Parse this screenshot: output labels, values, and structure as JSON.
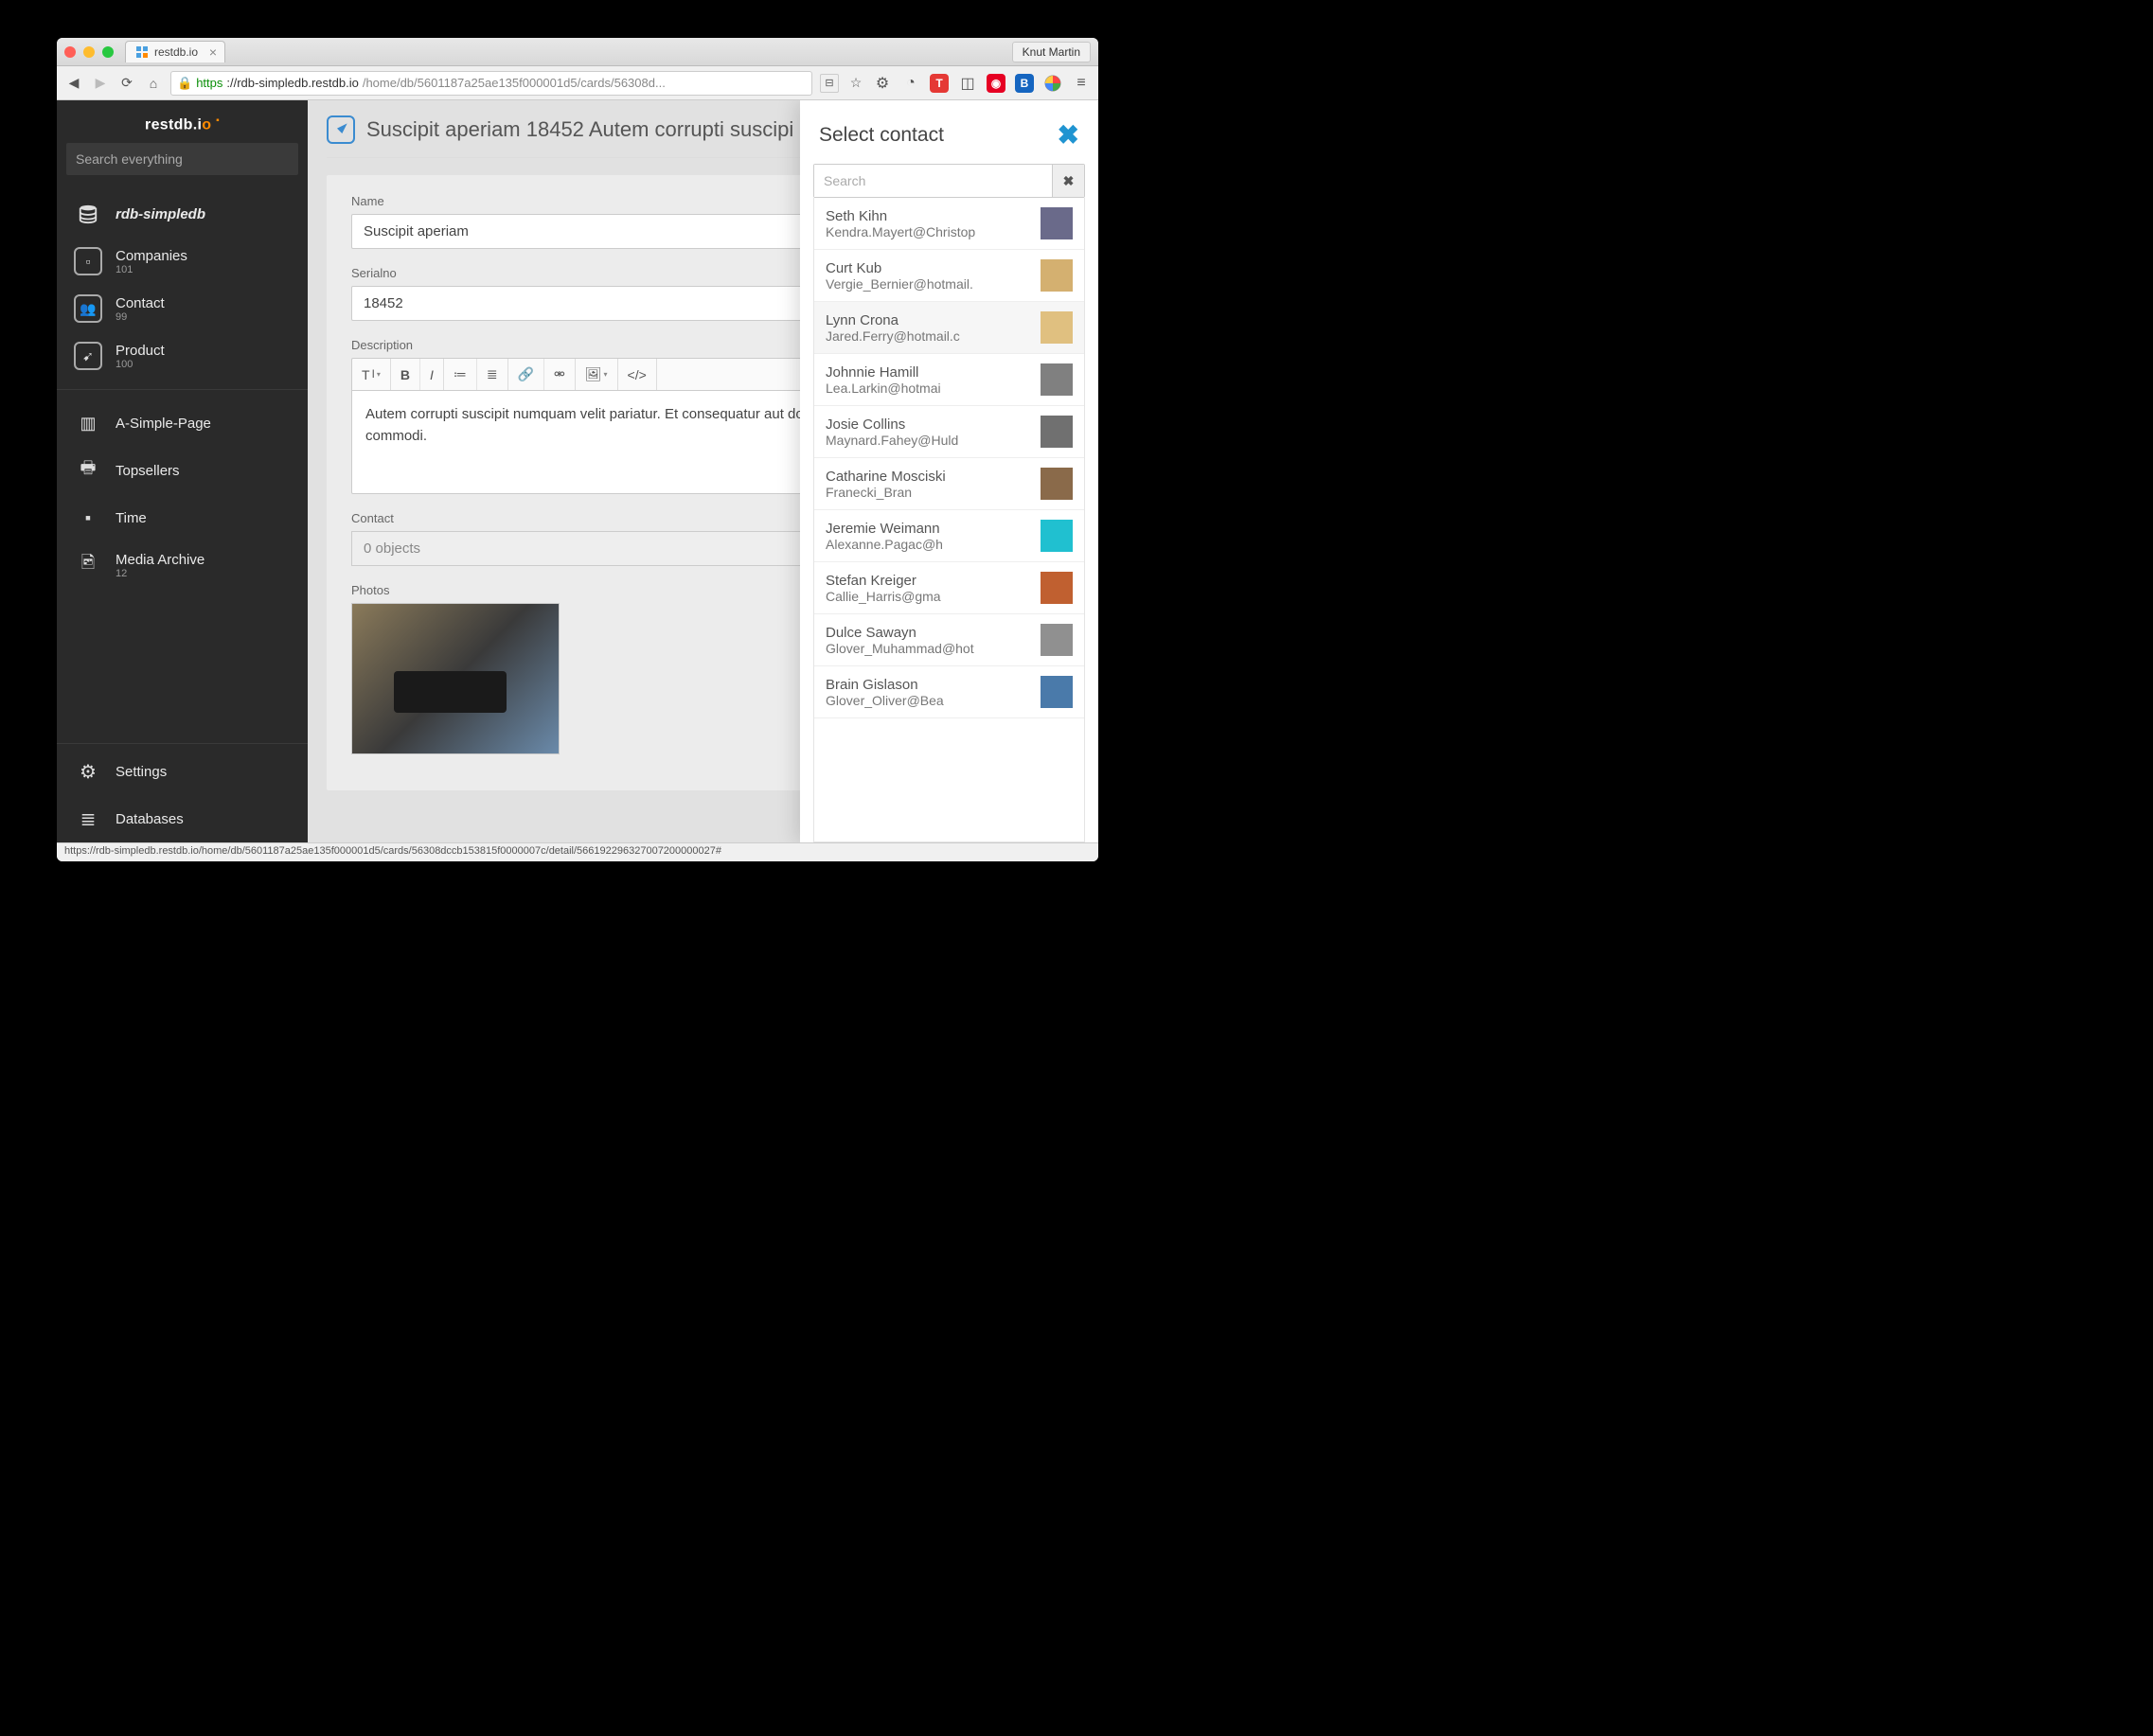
{
  "browser": {
    "tab_title": "restdb.io",
    "profile": "Knut Martin",
    "url_proto": "https",
    "url_host": "://rdb-simpledb.restdb.io",
    "url_path": "/home/db/5601187a25ae135f000001d5/cards/56308d...",
    "status_url": "https://rdb-simpledb.restdb.io/home/db/5601187a25ae135f000001d5/cards/56308dccb153815f0000007c/detail/566192296327007200000027#"
  },
  "sidebar": {
    "logo": "restdb.i",
    "logo_accent": "o",
    "search_placeholder": "Search everything",
    "db_name": "rdb-simpledb",
    "collections": [
      {
        "label": "Companies",
        "count": "101",
        "icon": "▫"
      },
      {
        "label": "Contact",
        "count": "99",
        "icon": "👥"
      },
      {
        "label": "Product",
        "count": "100",
        "icon": "➹"
      }
    ],
    "pages": [
      {
        "label": "A-Simple-Page",
        "icon": "▥"
      },
      {
        "label": "Topsellers",
        "icon": "🖶"
      },
      {
        "label": "Time",
        "icon": "▪"
      },
      {
        "label": "Media Archive",
        "count": "12",
        "icon": "🖻"
      }
    ],
    "bottom": [
      {
        "label": "Settings",
        "icon": "⚙"
      },
      {
        "label": "Databases",
        "icon": "≣"
      }
    ]
  },
  "main": {
    "title": "Suscipit aperiam 18452 Autem corrupti suscipi",
    "form": {
      "name_label": "Name",
      "name_value": "Suscipit aperiam",
      "serial_label": "Serialno",
      "serial_value": "18452",
      "desc_label": "Description",
      "desc_value": "Autem corrupti suscipit numquam velit pariatur. Et consequatur aut dolores hic. In exercitationem culpa commodi.",
      "contact_label": "Contact",
      "contact_value": "0 objects",
      "photos_label": "Photos"
    }
  },
  "drawer": {
    "title": "Select contact",
    "search_placeholder": "Search",
    "contacts": [
      {
        "name": "Seth Kihn",
        "email": "Kendra.Mayert@Christop",
        "color": "#6a6a8a"
      },
      {
        "name": "Curt Kub",
        "email": "Vergie_Bernier@hotmail.",
        "color": "#d4b070"
      },
      {
        "name": "Lynn Crona",
        "email": "Jared.Ferry@hotmail.c",
        "color": "#e0c080",
        "hover": true
      },
      {
        "name": "Johnnie Hamill",
        "email": "Lea.Larkin@hotmai",
        "color": "#808080"
      },
      {
        "name": "Josie Collins",
        "email": "Maynard.Fahey@Huld",
        "color": "#707070"
      },
      {
        "name": "Catharine Mosciski",
        "email": "Franecki_Bran",
        "color": "#8a6a4a"
      },
      {
        "name": "Jeremie Weimann",
        "email": "Alexanne.Pagac@h",
        "color": "#20c0d0"
      },
      {
        "name": "Stefan Kreiger",
        "email": "Callie_Harris@gma",
        "color": "#c06030"
      },
      {
        "name": "Dulce Sawayn",
        "email": "Glover_Muhammad@hot",
        "color": "#909090"
      },
      {
        "name": "Brain Gislason",
        "email": "Glover_Oliver@Bea",
        "color": "#4a7aaa"
      }
    ]
  }
}
